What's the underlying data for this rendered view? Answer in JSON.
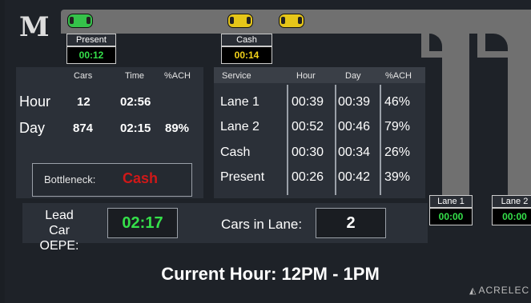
{
  "logo": {
    "text": "M"
  },
  "cars": [
    {
      "name": "present-car",
      "color": "#35c24a"
    },
    {
      "name": "cash-car-1",
      "color": "#e6c619"
    },
    {
      "name": "cash-car-2",
      "color": "#e6c619"
    }
  ],
  "stations": {
    "present": {
      "label": "Present",
      "time": "00:12",
      "color": "#35e04a"
    },
    "cash": {
      "label": "Cash",
      "time": "00:14",
      "color": "#f2d21a"
    },
    "lane1": {
      "label": "Lane 1",
      "time": "00:00",
      "color": "#35e04a"
    },
    "lane2": {
      "label": "Lane 2",
      "time": "00:00",
      "color": "#35e04a"
    }
  },
  "summary": {
    "headers": [
      "Cars",
      "Time",
      "%ACH"
    ],
    "rows": [
      {
        "label": "Hour",
        "cars": "12",
        "time": "02:56",
        "ach": ""
      },
      {
        "label": "Day",
        "cars": "874",
        "time": "02:15",
        "ach": "89%"
      }
    ]
  },
  "bottleneck": {
    "label": "Bottleneck:",
    "value": "Cash",
    "color": "#d01818"
  },
  "service": {
    "headers": [
      "Service",
      "Hour",
      "Day",
      "%ACH"
    ],
    "rows": [
      {
        "name": "Lane 1",
        "hour": "00:39",
        "day": "00:39",
        "ach": "46%"
      },
      {
        "name": "Lane 2",
        "hour": "00:52",
        "day": "00:46",
        "ach": "79%"
      },
      {
        "name": "Cash",
        "hour": "00:30",
        "day": "00:34",
        "ach": "26%"
      },
      {
        "name": "Present",
        "hour": "00:26",
        "day": "00:42",
        "ach": "39%"
      }
    ]
  },
  "lead_car": {
    "label_line1": "Lead Car",
    "label_line2": "OEPE:",
    "time": "02:17",
    "color": "#35e04a"
  },
  "cars_in_lane": {
    "label": "Cars in Lane:",
    "value": "2"
  },
  "footer": {
    "current_hour": "Current Hour:  12PM - 1PM"
  },
  "brand": {
    "text": "ACRELEC"
  }
}
